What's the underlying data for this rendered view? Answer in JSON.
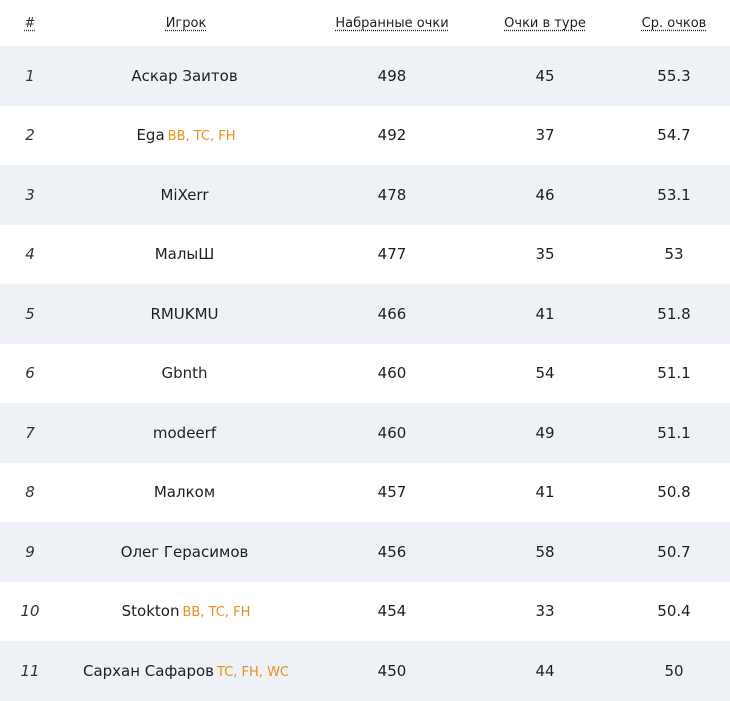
{
  "header": {
    "rank": "#",
    "player": "Игрок",
    "points": "Набранные очки",
    "gw_points": "Очки в туре",
    "avg": "Ср. очков"
  },
  "colors": {
    "row_shade": "#eef2f7",
    "chip_accent": "#e8901f"
  },
  "rows": [
    {
      "rank": "1",
      "player": "Аскар Заитов",
      "chips": "",
      "points": "498",
      "gw": "45",
      "avg": "55.3"
    },
    {
      "rank": "2",
      "player": "Ega",
      "chips": "BB, TC, FH",
      "points": "492",
      "gw": "37",
      "avg": "54.7"
    },
    {
      "rank": "3",
      "player": "MiXerr",
      "chips": "",
      "points": "478",
      "gw": "46",
      "avg": "53.1"
    },
    {
      "rank": "4",
      "player": "МалыШ",
      "chips": "",
      "points": "477",
      "gw": "35",
      "avg": "53"
    },
    {
      "rank": "5",
      "player": "RMUKMU",
      "chips": "",
      "points": "466",
      "gw": "41",
      "avg": "51.8"
    },
    {
      "rank": "6",
      "player": "Gbnth",
      "chips": "",
      "points": "460",
      "gw": "54",
      "avg": "51.1"
    },
    {
      "rank": "7",
      "player": "modeerf",
      "chips": "",
      "points": "460",
      "gw": "49",
      "avg": "51.1"
    },
    {
      "rank": "8",
      "player": "Малком",
      "chips": "",
      "points": "457",
      "gw": "41",
      "avg": "50.8"
    },
    {
      "rank": "9",
      "player": "Олег Герасимов",
      "chips": "",
      "points": "456",
      "gw": "58",
      "avg": "50.7"
    },
    {
      "rank": "10",
      "player": "Stokton",
      "chips": "BB, TC, FH",
      "points": "454",
      "gw": "33",
      "avg": "50.4"
    },
    {
      "rank": "11",
      "player": "Сархан Сафаров",
      "chips": "TC, FH, WC",
      "points": "450",
      "gw": "44",
      "avg": "50"
    }
  ]
}
